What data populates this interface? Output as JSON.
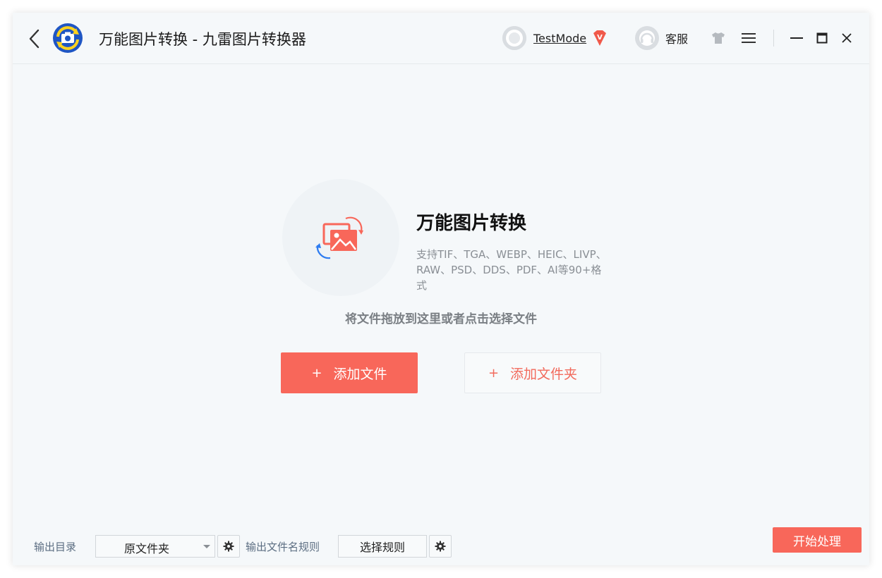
{
  "titlebar": {
    "app_title": "万能图片转换 - 九雷图片转换器",
    "username": "TestMode",
    "vip_badge": "V",
    "service_label": "客服"
  },
  "hero": {
    "title": "万能图片转换",
    "description": "支持TIF、TGA、WEBP、HEIC、LIVP、RAW、PSD、DDS、PDF、AI等90+格式",
    "drop_hint": "将文件拖放到这里或者点击选择文件"
  },
  "actions": {
    "add_file_plus": "+",
    "add_file_label": "添加文件",
    "add_folder_plus": "+",
    "add_folder_label": "添加文件夹"
  },
  "bottom": {
    "output_dir_label": "输出目录",
    "output_dir_value": "原文件夹",
    "output_name_rule_label": "输出文件名规则",
    "rule_button_label": "选择规则",
    "start_button_label": "开始处理"
  },
  "colors": {
    "accent": "#f8675a",
    "background": "#f5f8fa"
  }
}
